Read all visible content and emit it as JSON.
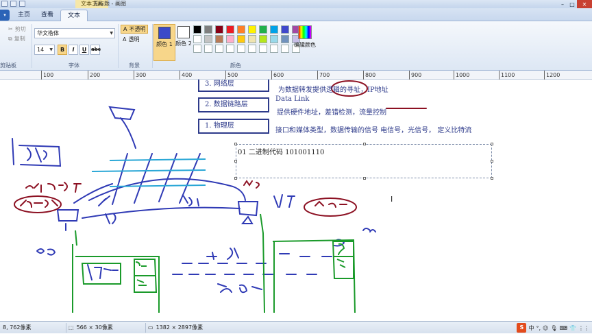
{
  "title": {
    "context_tab": "文本工具",
    "document": "无标题 - 画图"
  },
  "tabs": [
    {
      "label": "主页"
    },
    {
      "label": "查看"
    },
    {
      "label": "文本"
    }
  ],
  "ribbon": {
    "clipboard": {
      "cut": "剪切",
      "copy": "复制",
      "group": "剪贴板"
    },
    "font": {
      "family": "华文楷体",
      "size": "14",
      "bold": "B",
      "italic": "I",
      "underline": "U",
      "strike": "abc",
      "group": "字体"
    },
    "background": {
      "opaque": "不透明",
      "transparent": "透明",
      "group": "背景"
    },
    "colors": {
      "color1": "颜色 1",
      "color2": "颜色 2",
      "edit": "编辑颜色",
      "group": "颜色",
      "color1_value": "#3a49c9",
      "color2_value": "#ffffff"
    },
    "palette": [
      "#000000",
      "#7f7f7f",
      "#880015",
      "#ed1c24",
      "#ff7f27",
      "#fff200",
      "#22b14c",
      "#00a2e8",
      "#3f48cc",
      "#a349a4",
      "#ffffff",
      "#c3c3c3",
      "#b97a57",
      "#ffaec9",
      "#ffc90e",
      "#efe4b0",
      "#b5e61d",
      "#99d9ea",
      "#7092be",
      "#c8bfe7",
      "#ffffff",
      "#ffffff",
      "#ffffff",
      "#ffffff",
      "#ffffff",
      "#ffffff",
      "#ffffff",
      "#ffffff",
      "#ffffff",
      "#ffffff"
    ]
  },
  "ruler": [
    "100",
    "200",
    "300",
    "400",
    "500",
    "600",
    "700",
    "800",
    "900",
    "1000",
    "1100",
    "1200"
  ],
  "canvas": {
    "layers": [
      {
        "label": "3. 网络层",
        "desc": "为数据转发提供逻辑的寻址，IP地址"
      },
      {
        "label": "2. 数据链路层",
        "desc": "提供硬件地址，差错检测，流量控制",
        "extra": "Data Link"
      },
      {
        "label": "1. 物理层",
        "desc": "接口和媒体类型，数据传输的信号 电信号，光信号， 定义比特流"
      }
    ],
    "textbox_content": "01 二进制代码   101001110"
  },
  "status": {
    "cursor": "8, 762像素",
    "selection": "566 × 30像素",
    "image_size": "1382 × 2897像素",
    "ime": "中"
  }
}
